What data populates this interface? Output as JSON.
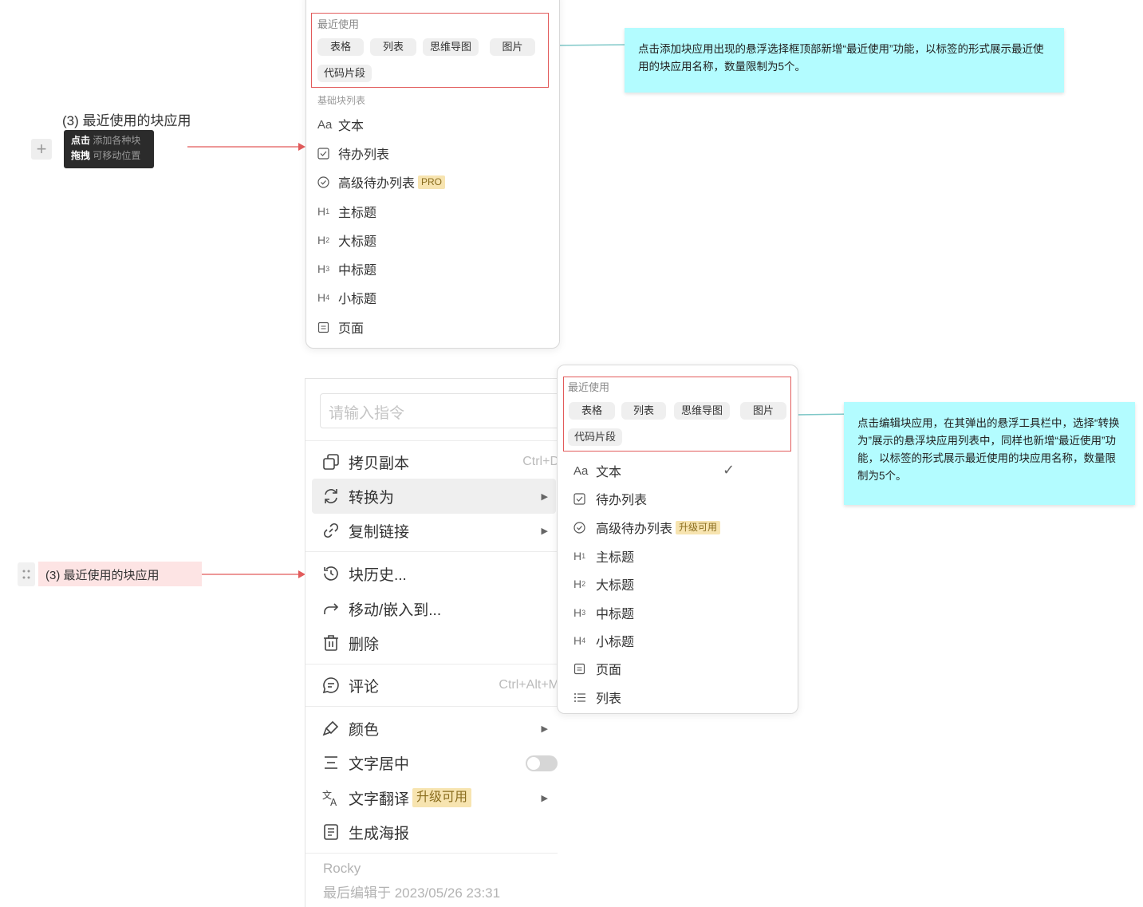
{
  "top_left": {
    "title": "(3) 最近使用的块应用",
    "tooltip_line1_bold": "点击",
    "tooltip_line1_rest": "添加各种块",
    "tooltip_line2_bold": "拖拽",
    "tooltip_line2_rest": "可移动位置"
  },
  "panel1": {
    "recent_title": "最近使用",
    "recent_chips": [
      "表格",
      "列表",
      "思维导图",
      "图片",
      "代码片段"
    ],
    "section_title": "基础块列表",
    "items": [
      {
        "icon": "Aa",
        "label": "文本"
      },
      {
        "icon": "checkbox-icon",
        "label": "待办列表"
      },
      {
        "icon": "check-circle-icon",
        "label": "高级待办列表",
        "badge": "PRO"
      },
      {
        "icon": "H1",
        "label": "主标题"
      },
      {
        "icon": "H2",
        "label": "大标题"
      },
      {
        "icon": "H3",
        "label": "中标题"
      },
      {
        "icon": "H4",
        "label": "小标题"
      },
      {
        "icon": "page-icon",
        "label": "页面"
      }
    ]
  },
  "note1": "点击添加块应用出现的悬浮选择框顶部新增“最近使用”功能，以标签的形式展示最近使用的块应用名称，数量限制为5个。",
  "bottom_left": {
    "block_label": "(3) 最近使用的块应用"
  },
  "context_menu": {
    "search_placeholder": "请输入指令",
    "items": [
      {
        "label": "拷贝副本",
        "shortcut": "Ctrl+D"
      },
      {
        "label": "转换为"
      },
      {
        "label": "复制链接"
      },
      {
        "label": "块历史..."
      },
      {
        "label": "移动/嵌入到..."
      },
      {
        "label": "删除"
      },
      {
        "label": "评论",
        "shortcut": "Ctrl+Alt+M"
      },
      {
        "label": "颜色"
      },
      {
        "label": "文字居中"
      },
      {
        "label": "文字翻译",
        "badge": "升级可用"
      },
      {
        "label": "生成海报"
      }
    ],
    "footer_user": "Rocky",
    "footer_edit": "最后编辑于 2023/05/26 23:31"
  },
  "panel2": {
    "recent_title": "最近使用",
    "recent_chips": [
      "表格",
      "列表",
      "思维导图",
      "图片",
      "代码片段"
    ],
    "items": [
      {
        "icon": "Aa",
        "label": "文本"
      },
      {
        "icon": "checkbox-icon",
        "label": "待办列表"
      },
      {
        "icon": "check-circle-icon",
        "label": "高级待办列表",
        "badge": "升级可用"
      },
      {
        "icon": "H1",
        "label": "主标题"
      },
      {
        "icon": "H2",
        "label": "大标题"
      },
      {
        "icon": "H3",
        "label": "中标题"
      },
      {
        "icon": "H4",
        "label": "小标题"
      },
      {
        "icon": "page-icon",
        "label": "页面"
      },
      {
        "icon": "list-icon",
        "label": "列表"
      }
    ]
  },
  "note2": "点击编辑块应用，在其弹出的悬浮工具栏中，选择“转换为”展示的悬浮块应用列表中，同样也新增“最近使用”功能，以标签的形式展示最近使用的块应用名称，数量限制为5个。",
  "colors": {
    "note_bg": "#b3fcff",
    "highlight_border": "#e25b5b",
    "arrow": "#e25b5b",
    "connector": "#7fc8c8",
    "badge_bg": "#f7e4b0"
  }
}
